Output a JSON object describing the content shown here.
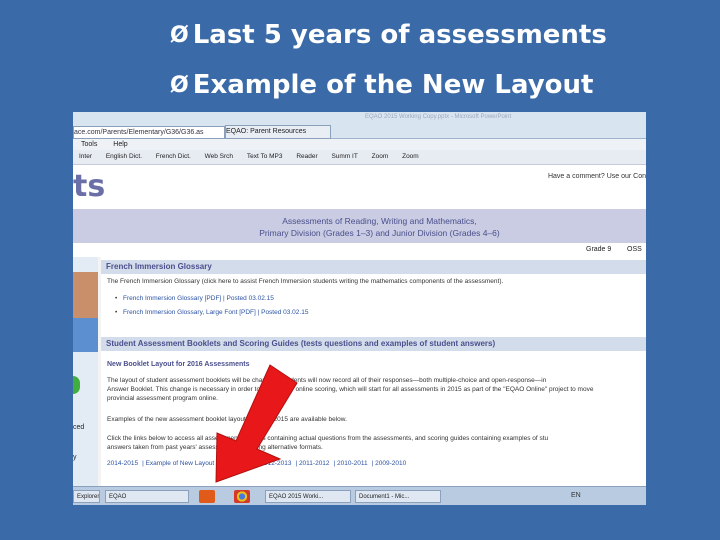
{
  "slide": {
    "bullet_glyph": "Ø",
    "bullets": [
      "Last 5 years of assessments",
      "Example of the New Layout"
    ],
    "colors": {
      "background": "#3a6aa8",
      "text": "#ffffff",
      "arrow": "#e8181a"
    }
  },
  "browser": {
    "url": "ace.com/Parents/Elementary/G36/G36.as",
    "tab_label": "EQAO: Parent Resources",
    "window_title": "EQAO 2015 Working Copy.pptx - Microsoft PowerPoint",
    "menu": [
      "Tools",
      "Help"
    ],
    "toolbar": [
      "Inter",
      "English Dict.",
      "French Dict.",
      "Web Srch",
      "Text To MP3",
      "Reader",
      "Summ IT",
      "Zoom",
      "Zoom"
    ]
  },
  "page": {
    "logo": "ts",
    "comment_link": "Have a comment? Use our Con",
    "heading_line1": "Assessments of Reading, Writing and Mathematics,",
    "heading_line2": "Primary Division (Grades 1–3) and Junior Division (Grades 4–6)",
    "grade_option1": "Grade 9",
    "grade_option2": "OSS",
    "left_text1": "ced",
    "left_text2": "y",
    "section1": {
      "title": "French Immersion Glossary",
      "text": "The French Immersion Glossary (click here to assist French Immersion students writing the mathematics components of the assessment).",
      "links": [
        "French Immersion Glossary [PDF] | Posted 03.02.15",
        "French Immersion Glossary, Large Font [PDF] | Posted 03.02.15"
      ]
    },
    "section2": {
      "title": "Student Assessment Booklets and Scoring Guides (tests questions and examples of student answers)",
      "subtitle": "New Booklet Layout for 2016 Assessments",
      "para1": "The layout of student assessment booklets will be changed. Students will now record all of their responses—both multiple-choice and open-response—in",
      "para2": "Answer Booklet. This change is necessary in order to prepare for online scoring, which will start for all assessments in 2015 as part of the \"EQAO Online\" project to move",
      "para3": "provincial assessment program online.",
      "para4": "Examples of the new assessment booklet layout for 2014-2015 are available below.",
      "para5": "Click the links below to access all assessment booklets containing actual questions from the assessments, and scoring guides containing examples of stu",
      "para6": "answers taken from past years' assessments, including alternative formats.",
      "links": [
        "2014-2015",
        "Example of New Layout",
        "2013-2014",
        "2012-2013",
        "2011-2012",
        "2010-2011",
        "2009-2010"
      ]
    }
  },
  "taskbar": {
    "items": [
      "Explorer",
      "EQAO",
      "EQAO 2015 Worki...",
      "Document1 - Mic..."
    ],
    "tray": "EN"
  }
}
